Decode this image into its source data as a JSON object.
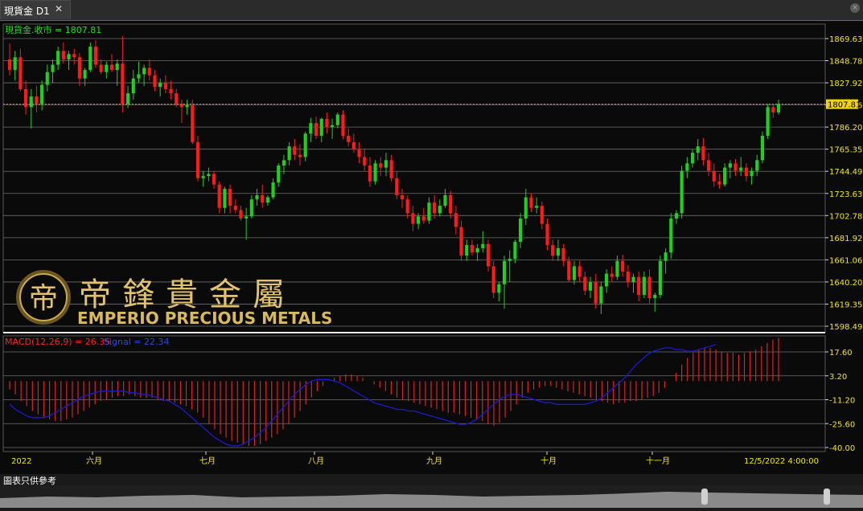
{
  "window": {
    "tab_title": "現貨金 D1",
    "tab_close": "✕",
    "disclaimer": "圖表只供參考"
  },
  "chart_data": [
    {
      "type": "candlestick",
      "title": "現貨金.收市 = 1807.81",
      "current_value": 1807.81,
      "y_ticks": [
        1869.63,
        1848.78,
        1827.92,
        1807.06,
        1786.2,
        1765.35,
        1744.49,
        1723.63,
        1702.78,
        1681.92,
        1661.06,
        1640.2,
        1619.35,
        1598.49
      ],
      "ylim": [
        1598.49,
        1880
      ],
      "grid": true,
      "colors": {
        "up": "#1fd01f",
        "down": "#ff1a1a",
        "last_price_line": "#d4a017",
        "price_label_bg": "#f2d400"
      },
      "x_labels": [
        "2022",
        "六月",
        "七月",
        "八月",
        "九月",
        "十月",
        "十一月",
        "12/5/2022 4:00:00"
      ],
      "ohlc": [
        [
          1850,
          1865,
          1835,
          1840
        ],
        [
          1840,
          1858,
          1830,
          1852
        ],
        [
          1852,
          1860,
          1820,
          1822
        ],
        [
          1822,
          1830,
          1798,
          1805
        ],
        [
          1805,
          1822,
          1785,
          1815
        ],
        [
          1815,
          1825,
          1800,
          1808
        ],
        [
          1808,
          1830,
          1802,
          1826
        ],
        [
          1826,
          1845,
          1820,
          1838
        ],
        [
          1838,
          1850,
          1828,
          1845
        ],
        [
          1845,
          1862,
          1840,
          1858
        ],
        [
          1858,
          1866,
          1846,
          1850
        ],
        [
          1850,
          1858,
          1840,
          1855
        ],
        [
          1855,
          1860,
          1845,
          1852
        ],
        [
          1852,
          1856,
          1825,
          1832
        ],
        [
          1832,
          1842,
          1825,
          1840
        ],
        [
          1840,
          1866,
          1838,
          1862
        ],
        [
          1862,
          1868,
          1842,
          1845
        ],
        [
          1845,
          1850,
          1836,
          1838
        ],
        [
          1838,
          1848,
          1832,
          1845
        ],
        [
          1845,
          1855,
          1838,
          1840
        ],
        [
          1840,
          1850,
          1825,
          1846
        ],
        [
          1846,
          1872,
          1800,
          1808
        ],
        [
          1808,
          1825,
          1804,
          1818
        ],
        [
          1818,
          1840,
          1812,
          1832
        ],
        [
          1832,
          1848,
          1828,
          1836
        ],
        [
          1836,
          1845,
          1825,
          1842
        ],
        [
          1842,
          1850,
          1830,
          1835
        ],
        [
          1835,
          1840,
          1820,
          1824
        ],
        [
          1824,
          1832,
          1815,
          1828
        ],
        [
          1828,
          1835,
          1818,
          1822
        ],
        [
          1822,
          1830,
          1812,
          1818
        ],
        [
          1818,
          1822,
          1805,
          1808
        ],
        [
          1808,
          1812,
          1790,
          1805
        ],
        [
          1805,
          1812,
          1798,
          1807
        ],
        [
          1807,
          1812,
          1770,
          1772
        ],
        [
          1772,
          1778,
          1735,
          1738
        ],
        [
          1738,
          1745,
          1730,
          1740
        ],
        [
          1740,
          1748,
          1735,
          1742
        ],
        [
          1742,
          1745,
          1728,
          1732
        ],
        [
          1732,
          1735,
          1705,
          1710
        ],
        [
          1710,
          1730,
          1705,
          1728
        ],
        [
          1728,
          1732,
          1705,
          1712
        ],
        [
          1712,
          1718,
          1705,
          1708
        ],
        [
          1708,
          1712,
          1698,
          1700
        ],
        [
          1700,
          1710,
          1680,
          1702
        ],
        [
          1702,
          1722,
          1700,
          1718
        ],
        [
          1718,
          1728,
          1712,
          1722
        ],
        [
          1722,
          1732,
          1710,
          1715
        ],
        [
          1715,
          1722,
          1712,
          1720
        ],
        [
          1720,
          1738,
          1718,
          1734
        ],
        [
          1734,
          1752,
          1730,
          1750
        ],
        [
          1750,
          1760,
          1742,
          1755
        ],
        [
          1755,
          1772,
          1750,
          1768
        ],
        [
          1768,
          1775,
          1755,
          1760
        ],
        [
          1760,
          1770,
          1750,
          1758
        ],
        [
          1758,
          1782,
          1754,
          1780
        ],
        [
          1780,
          1795,
          1772,
          1790
        ],
        [
          1790,
          1796,
          1775,
          1778
        ],
        [
          1778,
          1795,
          1772,
          1794
        ],
        [
          1794,
          1800,
          1780,
          1786
        ],
        [
          1786,
          1794,
          1775,
          1788
        ],
        [
          1788,
          1800,
          1785,
          1798
        ],
        [
          1798,
          1802,
          1775,
          1778
        ],
        [
          1778,
          1785,
          1768,
          1772
        ],
        [
          1772,
          1780,
          1762,
          1765
        ],
        [
          1765,
          1772,
          1752,
          1758
        ],
        [
          1758,
          1766,
          1745,
          1750
        ],
        [
          1750,
          1758,
          1730,
          1735
        ],
        [
          1735,
          1755,
          1732,
          1752
        ],
        [
          1752,
          1758,
          1740,
          1748
        ],
        [
          1748,
          1762,
          1740,
          1755
        ],
        [
          1755,
          1760,
          1735,
          1738
        ],
        [
          1738,
          1745,
          1718,
          1722
        ],
        [
          1722,
          1728,
          1710,
          1718
        ],
        [
          1718,
          1722,
          1700,
          1705
        ],
        [
          1705,
          1712,
          1688,
          1695
        ],
        [
          1695,
          1705,
          1690,
          1702
        ],
        [
          1702,
          1710,
          1695,
          1698
        ],
        [
          1698,
          1720,
          1695,
          1715
        ],
        [
          1715,
          1722,
          1700,
          1705
        ],
        [
          1705,
          1718,
          1702,
          1712
        ],
        [
          1712,
          1728,
          1710,
          1722
        ],
        [
          1722,
          1726,
          1700,
          1705
        ],
        [
          1705,
          1712,
          1685,
          1692
        ],
        [
          1692,
          1698,
          1660,
          1665
        ],
        [
          1665,
          1680,
          1660,
          1675
        ],
        [
          1675,
          1680,
          1665,
          1668
        ],
        [
          1668,
          1676,
          1660,
          1672
        ],
        [
          1672,
          1688,
          1668,
          1676
        ],
        [
          1676,
          1680,
          1650,
          1655
        ],
        [
          1655,
          1660,
          1625,
          1630
        ],
        [
          1630,
          1640,
          1622,
          1638
        ],
        [
          1638,
          1665,
          1615,
          1660
        ],
        [
          1660,
          1670,
          1640,
          1662
        ],
        [
          1662,
          1680,
          1658,
          1678
        ],
        [
          1678,
          1705,
          1672,
          1700
        ],
        [
          1700,
          1728,
          1694,
          1720
        ],
        [
          1720,
          1724,
          1706,
          1710
        ],
        [
          1710,
          1720,
          1705,
          1712
        ],
        [
          1712,
          1716,
          1690,
          1695
        ],
        [
          1695,
          1700,
          1670,
          1675
        ],
        [
          1675,
          1680,
          1660,
          1665
        ],
        [
          1665,
          1680,
          1660,
          1672
        ],
        [
          1672,
          1676,
          1655,
          1660
        ],
        [
          1660,
          1664,
          1640,
          1642
        ],
        [
          1642,
          1660,
          1638,
          1655
        ],
        [
          1655,
          1660,
          1640,
          1645
        ],
        [
          1645,
          1650,
          1628,
          1632
        ],
        [
          1632,
          1645,
          1625,
          1640
        ],
        [
          1640,
          1648,
          1615,
          1620
        ],
        [
          1620,
          1640,
          1610,
          1636
        ],
        [
          1636,
          1652,
          1630,
          1648
        ],
        [
          1648,
          1655,
          1640,
          1645
        ],
        [
          1645,
          1665,
          1642,
          1660
        ],
        [
          1660,
          1666,
          1645,
          1650
        ],
        [
          1650,
          1656,
          1635,
          1640
        ],
        [
          1640,
          1648,
          1630,
          1645
        ],
        [
          1645,
          1650,
          1622,
          1628
        ],
        [
          1628,
          1650,
          1625,
          1645
        ],
        [
          1645,
          1652,
          1620,
          1625
        ],
        [
          1625,
          1630,
          1612,
          1628
        ],
        [
          1628,
          1665,
          1625,
          1660
        ],
        [
          1660,
          1672,
          1648,
          1668
        ],
        [
          1668,
          1705,
          1662,
          1700
        ],
        [
          1700,
          1708,
          1695,
          1705
        ],
        [
          1705,
          1750,
          1700,
          1745
        ],
        [
          1745,
          1758,
          1738,
          1752
        ],
        [
          1752,
          1765,
          1748,
          1762
        ],
        [
          1762,
          1775,
          1755,
          1768
        ],
        [
          1768,
          1776,
          1750,
          1755
        ],
        [
          1755,
          1762,
          1740,
          1745
        ],
        [
          1745,
          1752,
          1730,
          1735
        ],
        [
          1735,
          1742,
          1728,
          1732
        ],
        [
          1732,
          1752,
          1730,
          1748
        ],
        [
          1748,
          1755,
          1738,
          1752
        ],
        [
          1752,
          1756,
          1740,
          1745
        ],
        [
          1745,
          1758,
          1740,
          1748
        ],
        [
          1748,
          1752,
          1735,
          1740
        ],
        [
          1740,
          1748,
          1732,
          1745
        ],
        [
          1745,
          1760,
          1740,
          1755
        ],
        [
          1755,
          1782,
          1752,
          1778
        ],
        [
          1778,
          1808,
          1775,
          1805
        ],
        [
          1805,
          1808,
          1795,
          1800
        ],
        [
          1800,
          1812,
          1798,
          1808
        ]
      ]
    },
    {
      "type": "bar+line",
      "title": "MACD(12,26,9) = 26.35",
      "signal_label": "Signal = 22.34",
      "macd_value": 26.35,
      "signal_value": 22.34,
      "y_ticks": [
        17.6,
        3.2,
        -11.2,
        -25.6,
        -40.0
      ],
      "ylim": [
        -44,
        26
      ],
      "colors": {
        "histogram": "#e02020",
        "signal": "#1a1ad0",
        "title": "#ff2020",
        "signal_title": "#2a4ad8"
      },
      "macd": [
        -5,
        -8,
        -12,
        -15,
        -18,
        -20,
        -22,
        -23,
        -24,
        -24,
        -23,
        -22,
        -20,
        -18,
        -16,
        -14,
        -12,
        -11,
        -10,
        -9,
        -9,
        -8,
        -9,
        -10,
        -10,
        -10,
        -11,
        -12,
        -12,
        -13,
        -14,
        -15,
        -17,
        -19,
        -22,
        -26,
        -29,
        -32,
        -34,
        -36,
        -37,
        -38,
        -39,
        -39,
        -38,
        -36,
        -34,
        -32,
        -29,
        -26,
        -22,
        -18,
        -14,
        -10,
        -6,
        -3,
        0,
        2,
        3,
        4,
        4,
        3,
        2,
        0,
        -2,
        -4,
        -6,
        -8,
        -10,
        -11,
        -12,
        -13,
        -14,
        -15,
        -16,
        -17,
        -18,
        -19,
        -19,
        -20,
        -21,
        -22,
        -23,
        -24,
        -26,
        -27,
        -25,
        -22,
        -18,
        -14,
        -10,
        -7,
        -5,
        -4,
        -3,
        -3,
        -4,
        -5,
        -6,
        -7,
        -8,
        -9,
        -10,
        -11,
        -12,
        -13,
        -14,
        -13,
        -13,
        -12,
        -12,
        -11,
        -10,
        -9,
        -7,
        -4,
        0,
        5,
        10,
        14,
        17,
        19,
        20,
        20,
        19,
        18,
        17,
        17,
        16,
        17,
        18,
        19,
        21,
        23,
        25,
        26
      ],
      "signal": [
        -14,
        -17,
        -19,
        -21,
        -22,
        -22,
        -22,
        -21,
        -19,
        -17,
        -15,
        -13,
        -11,
        -9,
        -8,
        -7,
        -6,
        -6,
        -6,
        -6,
        -6,
        -7,
        -7,
        -8,
        -8,
        -9,
        -10,
        -11,
        -12,
        -14,
        -16,
        -19,
        -22,
        -25,
        -28,
        -31,
        -34,
        -36,
        -38,
        -39,
        -39,
        -38,
        -36,
        -34,
        -31,
        -28,
        -24,
        -20,
        -16,
        -12,
        -8,
        -5,
        -2,
        0,
        1,
        1,
        1,
        0,
        -1,
        -3,
        -5,
        -7,
        -9,
        -11,
        -13,
        -14,
        -15,
        -16,
        -17,
        -17,
        -18,
        -18,
        -19,
        -20,
        -21,
        -22,
        -23,
        -24,
        -25,
        -26,
        -26,
        -25,
        -23,
        -20,
        -17,
        -14,
        -11,
        -9,
        -8,
        -8,
        -9,
        -10,
        -11,
        -12,
        -13,
        -13,
        -14,
        -14,
        -14,
        -14,
        -14,
        -14,
        -13,
        -12,
        -10,
        -7,
        -4,
        -1,
        2,
        6,
        10,
        13,
        16,
        18,
        19,
        20,
        20,
        19,
        19,
        18,
        18,
        19,
        20,
        21,
        22
      ]
    }
  ]
}
